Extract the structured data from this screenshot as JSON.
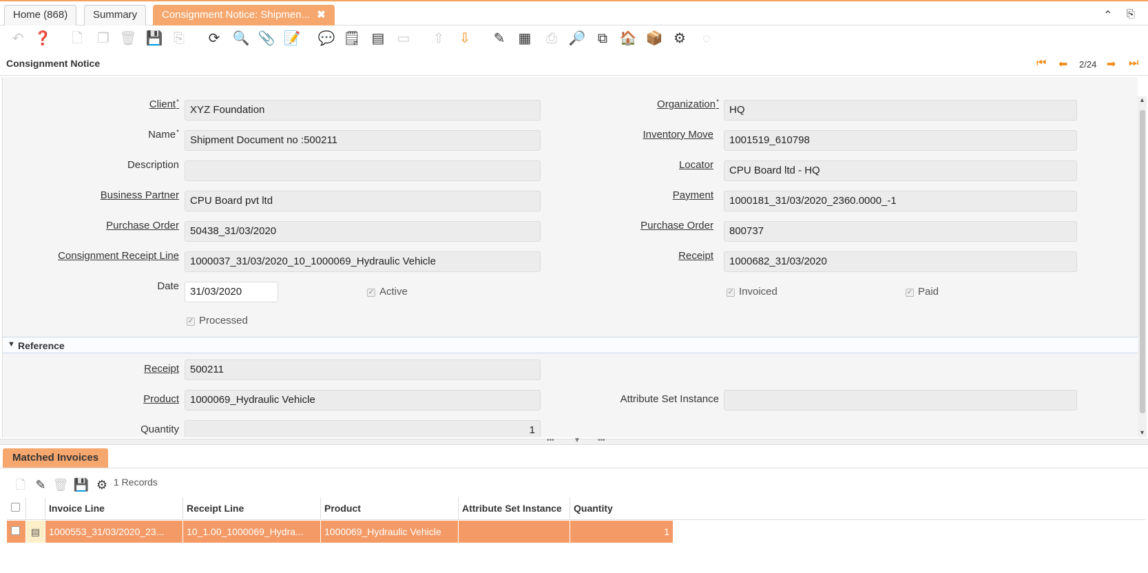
{
  "tabs": [
    {
      "label": "Home (868)"
    },
    {
      "label": "Summary"
    },
    {
      "label": "Consignment Notice: Shipmen...",
      "close": "✖"
    }
  ],
  "window": {
    "title": "Consignment Notice",
    "record_position": "2/24"
  },
  "form": {
    "client": {
      "label": "Client",
      "value": "XYZ Foundation"
    },
    "organization": {
      "label": "Organization",
      "value": "HQ"
    },
    "name": {
      "label": "Name",
      "value": "Shipment Document no :500211"
    },
    "inventory_move": {
      "label": "Inventory Move",
      "value": "1001519_610798"
    },
    "description": {
      "label": "Description",
      "value": ""
    },
    "locator": {
      "label": "Locator",
      "value": "CPU Board ltd - HQ"
    },
    "business_partner": {
      "label": "Business Partner",
      "value": "CPU Board pvt ltd"
    },
    "payment": {
      "label": "Payment",
      "value": "1000181_31/03/2020_2360.0000_-1"
    },
    "purchase_order_left": {
      "label": "Purchase Order",
      "value": "50438_31/03/2020"
    },
    "purchase_order_right": {
      "label": "Purchase Order",
      "value": "800737"
    },
    "consignment_receipt_line": {
      "label": "Consignment Receipt Line",
      "value": "1000037_31/03/2020_10_1000069_Hydraulic Vehicle"
    },
    "receipt_top": {
      "label": "Receipt",
      "value": "1000682_31/03/2020"
    },
    "date": {
      "label": "Date",
      "value": "31/03/2020"
    },
    "active": {
      "label": "Active",
      "checked": true
    },
    "invoiced": {
      "label": "Invoiced",
      "checked": true
    },
    "paid": {
      "label": "Paid",
      "checked": true
    },
    "processed": {
      "label": "Processed",
      "checked": true
    },
    "required_mark": "*",
    "check_mark": "✓"
  },
  "reference": {
    "title": "Reference",
    "receipt": {
      "label": "Receipt",
      "value": "500211"
    },
    "product": {
      "label": "Product",
      "value": "1000069_Hydraulic Vehicle"
    },
    "attribute_set_instance": {
      "label": "Attribute Set Instance",
      "value": ""
    },
    "quantity": {
      "label": "Quantity",
      "value": "1"
    }
  },
  "detail": {
    "tab_label": "Matched Invoices",
    "records": "1 Records",
    "columns": [
      "Invoice Line",
      "Receipt Line",
      "Product",
      "Attribute Set Instance",
      "Quantity"
    ],
    "rows": [
      {
        "invoice_line": "1000553_31/03/2020_23...",
        "receipt_line": "10_1.00_1000069_Hydra...",
        "product": "1000069_Hydraulic Vehicle",
        "attribute_set_instance": "",
        "quantity": "1"
      }
    ]
  },
  "colors": {
    "accent": "#f6a76e",
    "selected_row": "#f39a66",
    "nav": "#f08c1a"
  }
}
